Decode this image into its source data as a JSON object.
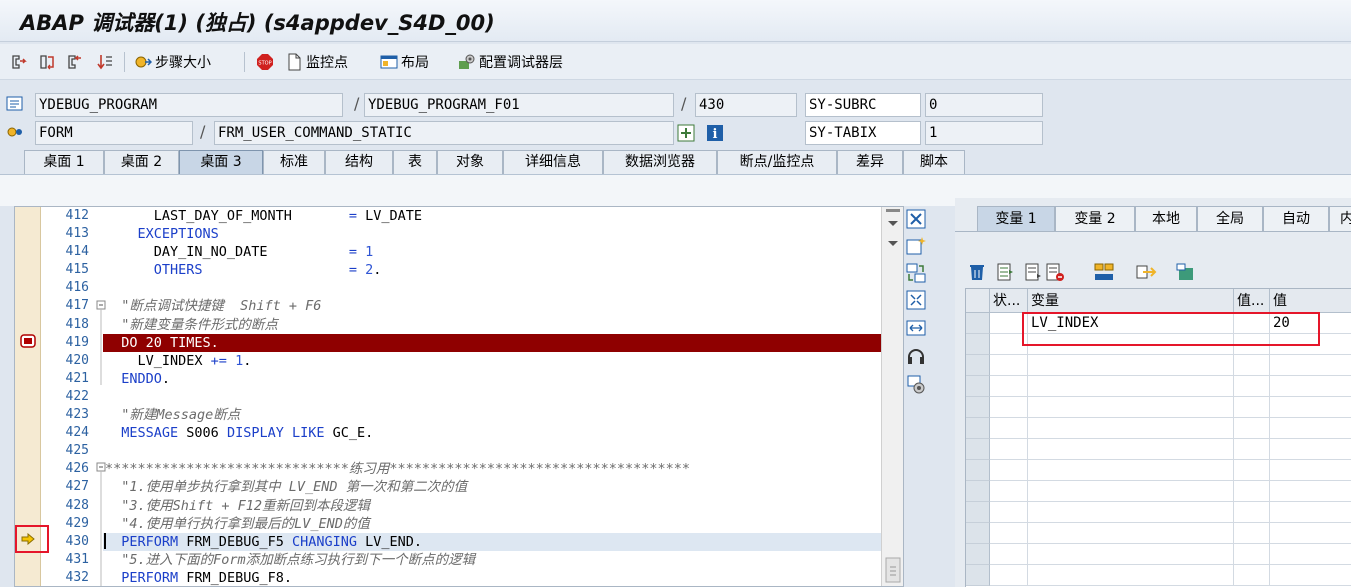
{
  "window": {
    "title": "ABAP 调试器(1)  (独占) (s4appdev_S4D_00)"
  },
  "toolbar": {
    "steps_label": "步骤大小",
    "watchpoint_label": "监控点",
    "layout_label": "布局",
    "config_label": "配置调试器层"
  },
  "context": {
    "program": "YDEBUG_PROGRAM",
    "include": "YDEBUG_PROGRAM_F01",
    "line": "430",
    "sy1_name": "SY-SUBRC",
    "sy1_value": "0",
    "event_type": "FORM",
    "event_name": "FRM_USER_COMMAND_STATIC",
    "sy2_name": "SY-TABIX",
    "sy2_value": "1"
  },
  "tabs": [
    "桌面 1",
    "桌面 2",
    "桌面 3",
    "标准",
    "结构",
    "表",
    "对象",
    "详细信息",
    "数据浏览器",
    "断点/监控点",
    "差异",
    "脚本"
  ],
  "active_tab": "桌面 3",
  "editor": {
    "line_numbers": [
      "412",
      "413",
      "414",
      "415",
      "416",
      "417",
      "418",
      "419",
      "420",
      "421",
      "422",
      "423",
      "424",
      "425",
      "426",
      "427",
      "428",
      "429",
      "430",
      "431",
      "432"
    ],
    "breakpoint_line": "419",
    "current_line": "430"
  },
  "var_tabs": [
    "变量 1",
    "变量 2",
    "本地",
    "全局",
    "自动",
    "内"
  ],
  "active_var_tab": "变量 1",
  "grid": {
    "headers": {
      "status": "状...",
      "variable": "变量",
      "value_short": "值...",
      "value": "值"
    },
    "rows": [
      {
        "variable": "LV_INDEX",
        "value": "20"
      }
    ]
  },
  "colors": {
    "breakpoint_bg": "#8f0000",
    "highlight_box": "#e5162a",
    "keyword": "#1b3fc9",
    "comment": "#6b6b6b"
  }
}
